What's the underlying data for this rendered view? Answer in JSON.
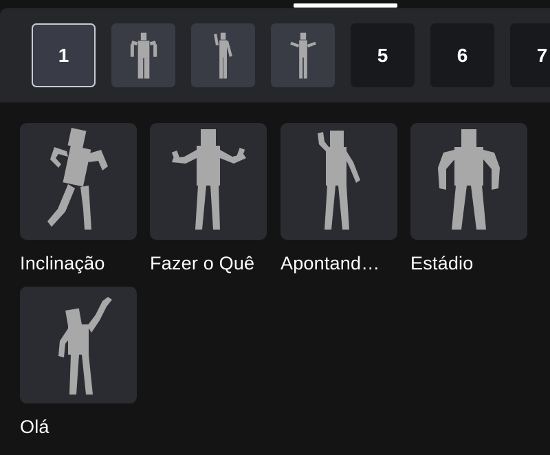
{
  "slots": [
    {
      "type": "number",
      "label": "1",
      "selected": true
    },
    {
      "type": "emote",
      "icon": "emote-stadium-icon"
    },
    {
      "type": "emote",
      "icon": "emote-pointing-icon"
    },
    {
      "type": "emote",
      "icon": "emote-shrug-icon"
    },
    {
      "type": "number",
      "label": "5"
    },
    {
      "type": "number",
      "label": "6"
    },
    {
      "type": "number",
      "label": "7"
    }
  ],
  "emotes": [
    {
      "label": "Inclinação",
      "icon": "emote-tilt-icon"
    },
    {
      "label": "Fazer o Quê",
      "icon": "emote-shrug-icon"
    },
    {
      "label": "Apontand…",
      "icon": "emote-pointing-icon"
    },
    {
      "label": "Estádio",
      "icon": "emote-stadium-icon"
    },
    {
      "label": "Olá",
      "icon": "emote-wave-icon"
    }
  ],
  "colors": {
    "background": "#141414",
    "slot_bar": "#25272a",
    "slot_filled": "#393c45",
    "slot_empty": "#18191c",
    "tile": "#2a2c31",
    "figure": "#a8a8a8",
    "text": "#ffffff"
  }
}
